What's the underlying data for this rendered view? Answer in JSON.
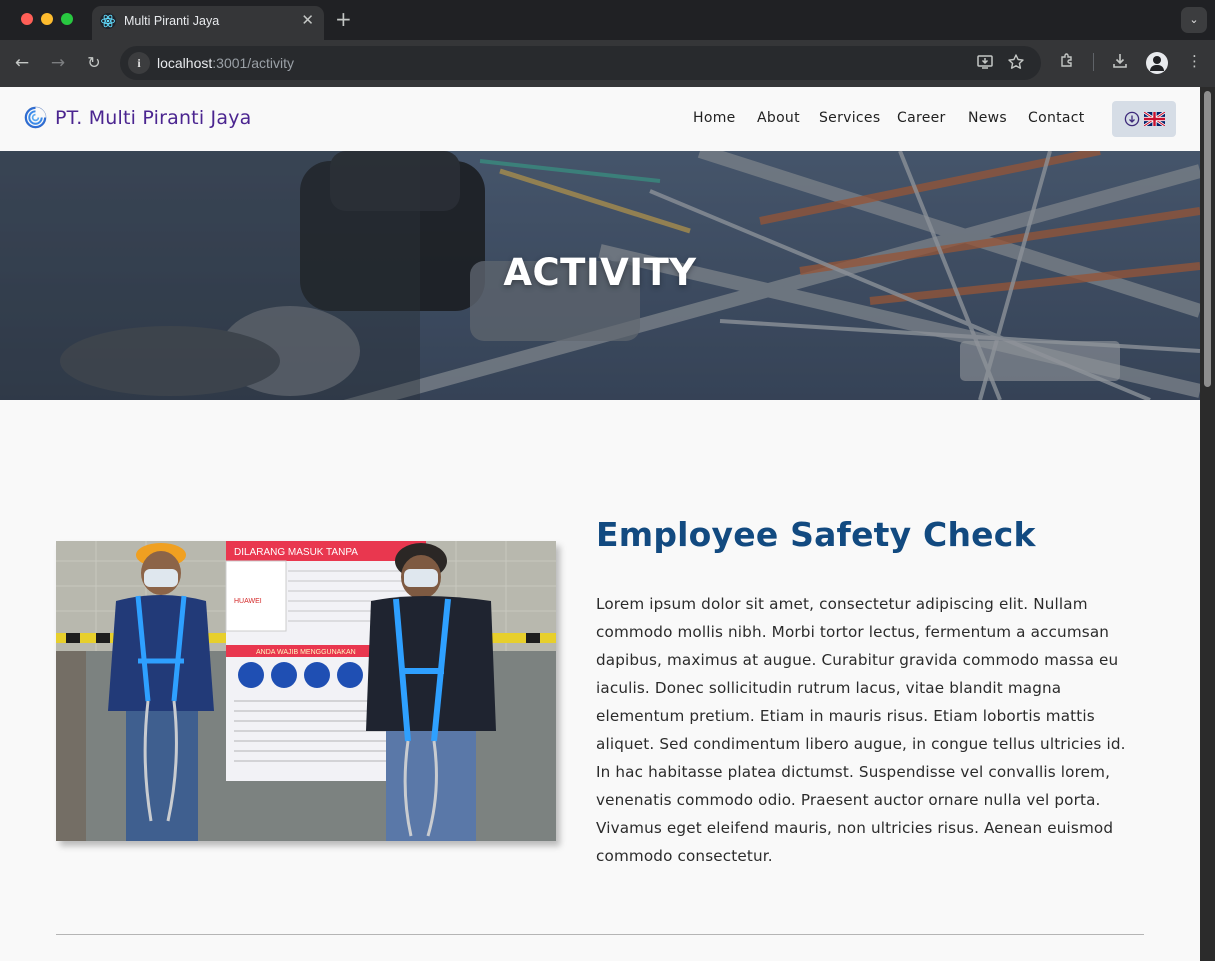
{
  "browser": {
    "tab_title": "Multi Piranti Jaya",
    "tab_close": "✕",
    "new_tab": "+",
    "url_host": "localhost",
    "url_rest": ":3001/activity",
    "icons": [
      "back-arrow-icon",
      "forward-arrow-icon",
      "reload-icon",
      "site-info-icon",
      "install-app-icon",
      "bookmark-star-icon",
      "extensions-icon",
      "download-icon",
      "profile-icon",
      "menu-kebab-icon"
    ]
  },
  "header": {
    "brand_name": "PT. Multi Piranti Jaya",
    "brand_color": "#4b2590",
    "nav": [
      "Home",
      "About",
      "Services",
      "Career",
      "News",
      "Contact"
    ]
  },
  "hero": {
    "title": "ACTIVITY"
  },
  "activity": {
    "title": "Employee Safety Check",
    "title_color": "#124a80",
    "photo_signage": [
      "DILARANG MASUK TANPA",
      "HUAWEI",
      "ANDA WAJIB MENGGUNAKAN"
    ],
    "body": "Lorem ipsum dolor sit amet, consectetur adipiscing elit. Nullam commodo mollis nibh. Morbi tortor lectus, fermentum a accumsan dapibus, maximus at augue. Curabitur gravida commodo massa eu iaculis. Donec sollicitudin rutrum lacus, vitae blandit magna elementum pretium. Etiam in mauris risus. Etiam lobortis mattis aliquet. Sed condimentum libero augue, in congue tellus ultricies id. In hac habitasse platea dictumst. Suspendisse vel convallis lorem, venenatis commodo odio. Praesent auctor ornare nulla vel porta. Vivamus eget eleifend mauris, non ultricies risus. Aenean euismod commodo consectetur."
  }
}
